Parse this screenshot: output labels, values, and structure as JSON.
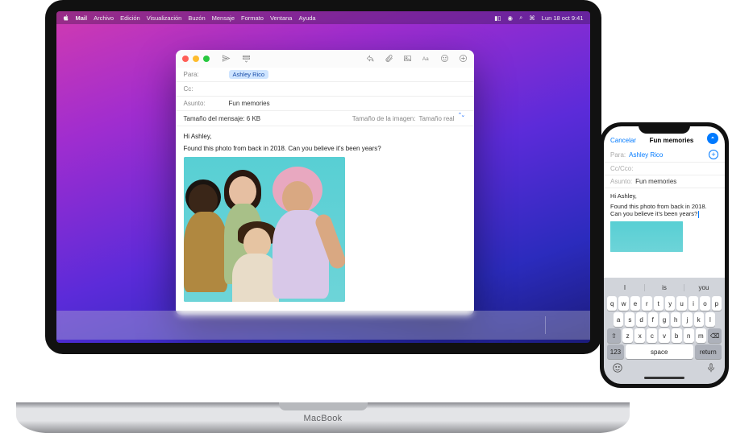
{
  "menubar": {
    "app": "Mail",
    "items": [
      "Archivo",
      "Edición",
      "Visualización",
      "Buzón",
      "Mensaje",
      "Formato",
      "Ventana",
      "Ayuda"
    ],
    "clock": "Lun 18 oct  9:41"
  },
  "compose": {
    "to_label": "Para:",
    "to_value": "Ashley Rico",
    "cc_label": "Cc:",
    "subject_label": "Asunto:",
    "subject_value": "Fun memories",
    "size_label": "Tamaño del mensaje: 6 KB",
    "imgsize_label": "Tamaño de la imagen:",
    "imgsize_value": "Tamaño real",
    "greeting": "Hi Ashley,",
    "line": "Found this photo from back in 2018. Can you believe it's been years?"
  },
  "iphone": {
    "cancel": "Cancelar",
    "title": "Fun memories",
    "to_label": "Para:",
    "to_value": "Ashley Rico",
    "cc_label": "Cc/Cco:",
    "subject_label": "Asunto:",
    "subject_value": "Fun memories",
    "greeting": "Hi Ashley,",
    "line": "Found this photo from back in 2018. Can you believe it's been years?",
    "predictions": [
      "I",
      "is",
      "you"
    ],
    "keys_r1": [
      "q",
      "w",
      "e",
      "r",
      "t",
      "y",
      "u",
      "i",
      "o",
      "p"
    ],
    "keys_r2": [
      "a",
      "s",
      "d",
      "f",
      "g",
      "h",
      "j",
      "k",
      "l"
    ],
    "keys_r3": [
      "z",
      "x",
      "c",
      "v",
      "b",
      "n",
      "m"
    ],
    "key_123": "123",
    "key_space": "space",
    "key_return": "return"
  },
  "macbook_label": "MacBook",
  "dock_colors": [
    "#37d",
    "#3bd",
    "#3cd",
    "#58d",
    "#fc3",
    "#e33",
    "#3c6",
    "#38e",
    "#fff",
    "#e84",
    "#fff",
    "#fff",
    "#fff",
    "#28d",
    "#333",
    "#f3a",
    "#b5e",
    "#38c",
    "#fa4",
    "#3c7",
    "#f93",
    "#3ae",
    "#fff",
    "#58e",
    "#888"
  ]
}
